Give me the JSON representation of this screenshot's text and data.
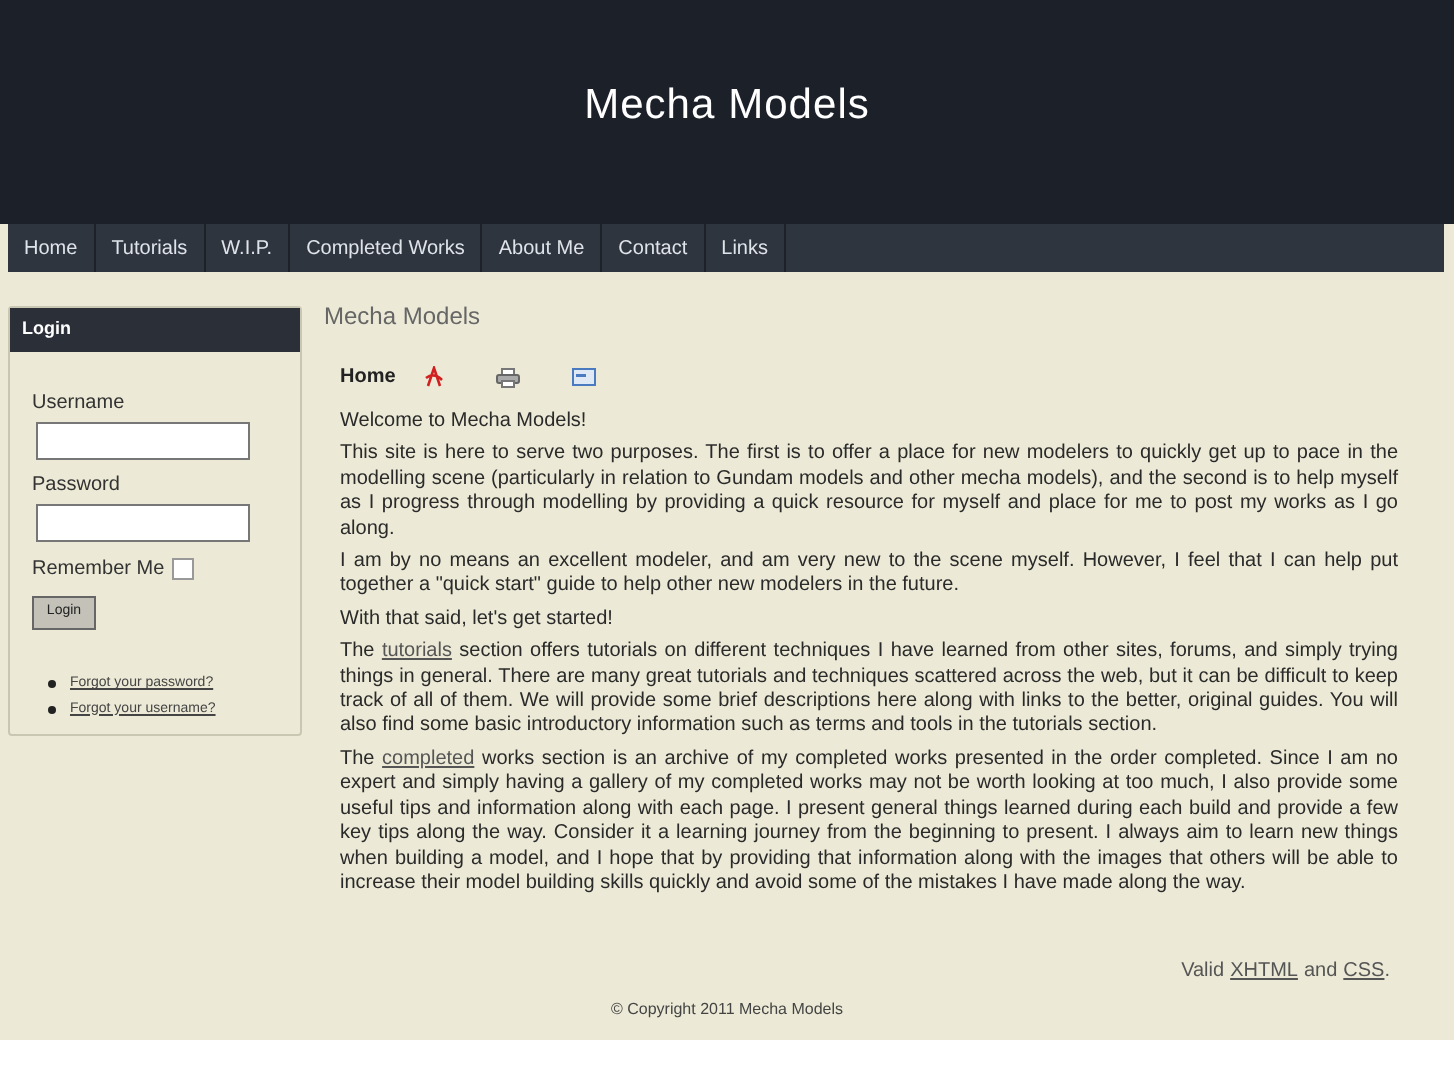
{
  "site_title": "Mecha Models",
  "nav": [
    {
      "label": "Home"
    },
    {
      "label": "Tutorials"
    },
    {
      "label": "W.I.P."
    },
    {
      "label": "Completed Works"
    },
    {
      "label": "About Me"
    },
    {
      "label": "Contact"
    },
    {
      "label": "Links"
    }
  ],
  "login": {
    "title": "Login",
    "username_label": "Username",
    "password_label": "Password",
    "remember_label": "Remember Me",
    "remember_checked": false,
    "button": "Login",
    "links": [
      "Forgot your password?",
      "Forgot your username?"
    ]
  },
  "content": {
    "heading": "Mecha Models",
    "article_title": "Home",
    "paragraphs": [
      {
        "before": "Welcome to Mecha Models!"
      },
      {
        "before": "This site is here to serve two purposes.  The first is to offer a place for new modelers to quickly get up to pace in the modelling scene (particularly in relation to Gundam models and other mecha models), and the second is to help myself as I progress through modelling by providing a quick resource for myself and place for me to post my works as I go along."
      },
      {
        "before": "I am by no means an excellent modeler, and am very new to the scene myself.  However, I feel that I can help put together a \"quick start\" guide to help other new modelers in the future."
      },
      {
        "before": "With that said, let's get started!"
      },
      {
        "before": "The ",
        "link": "tutorials",
        "after": " section offers tutorials on different techniques I have learned from other sites, forums, and simply trying things in general.  There are many great tutorials and techniques scattered across the web, but it can be difficult to keep track of all of them.  We will provide some brief descriptions here along with links to the better, original guides.  You will also find some basic introductory information such as terms and tools in the tutorials section."
      },
      {
        "before": "The ",
        "link": "completed",
        "after": " works section is an archive of my completed works presented in the order completed.  Since I am no expert and simply having a gallery of my completed works may not be worth looking at too much, I also provide some useful tips and information along with each page.  I present general things learned during each build and provide a few key tips along the way.  Consider it a learning journey from the beginning to present.  I always aim to learn new things when building a model, and I hope that by providing that information along with the images that others will be able to increase their model building skills quickly and avoid some of the mistakes I have made along the way."
      }
    ]
  },
  "footer": {
    "valid_prefix": "Valid",
    "xhtml_link": "XHTML",
    "and": "and",
    "css_link": "CSS",
    "period": ".",
    "copyright": "© Copyright 2011 Mecha Models"
  }
}
